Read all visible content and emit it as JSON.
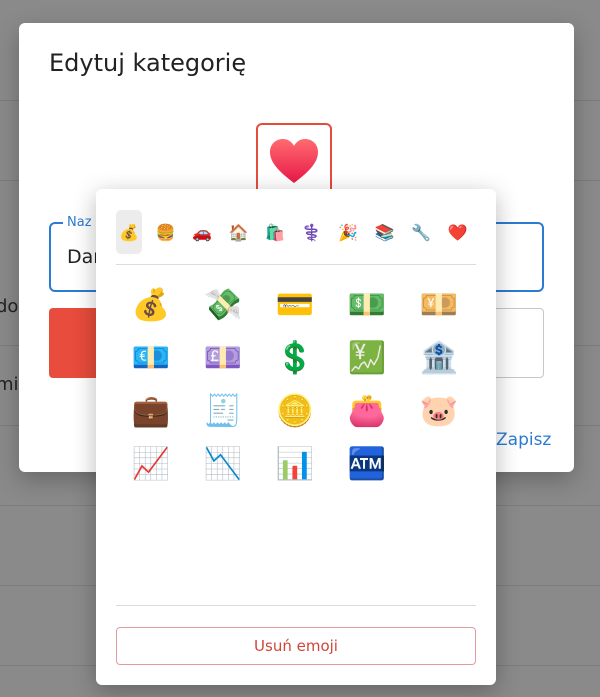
{
  "background": {
    "row_texts": [
      "do",
      "mi"
    ]
  },
  "dialog": {
    "title": "Edytuj kategorię",
    "selected_emoji": "heart",
    "name_label": "Naz",
    "name_value": "Dar",
    "save_label": "Zapisz",
    "accent_color": "#2b7bd3",
    "swatch_color": "#e74c3c"
  },
  "picker": {
    "categories": [
      {
        "glyph": "💰",
        "name": "money-bag"
      },
      {
        "glyph": "🍔",
        "name": "burger"
      },
      {
        "glyph": "🚗",
        "name": "car"
      },
      {
        "glyph": "🏠",
        "name": "house"
      },
      {
        "glyph": "🛍️",
        "name": "shopping-bags"
      },
      {
        "glyph": "⚕️",
        "name": "medical"
      },
      {
        "glyph": "🎉",
        "name": "party-popper"
      },
      {
        "glyph": "📚",
        "name": "books"
      },
      {
        "glyph": "🔧",
        "name": "wrench"
      },
      {
        "glyph": "❤️",
        "name": "heart"
      }
    ],
    "emojis": [
      {
        "glyph": "💰",
        "name": "money-bag"
      },
      {
        "glyph": "💸",
        "name": "money-with-wings"
      },
      {
        "glyph": "💳",
        "name": "credit-card"
      },
      {
        "glyph": "💵",
        "name": "dollar-banknote"
      },
      {
        "glyph": "💴",
        "name": "yen-banknote"
      },
      {
        "glyph": "💶",
        "name": "euro-banknote"
      },
      {
        "glyph": "💷",
        "name": "pound-banknote"
      },
      {
        "glyph": "💲",
        "name": "dollar-sign"
      },
      {
        "glyph": "💹",
        "name": "chart-with-yen"
      },
      {
        "glyph": "🏦",
        "name": "bank"
      },
      {
        "glyph": "💼",
        "name": "briefcase"
      },
      {
        "glyph": "🧾",
        "name": "receipt"
      },
      {
        "glyph": "🪙",
        "name": "coin"
      },
      {
        "glyph": "👛",
        "name": "purse"
      },
      {
        "glyph": "🐷",
        "name": "pig-face"
      },
      {
        "glyph": "📈",
        "name": "chart-increasing"
      },
      {
        "glyph": "📉",
        "name": "chart-decreasing"
      },
      {
        "glyph": "📊",
        "name": "bar-chart"
      },
      {
        "glyph": "🏧",
        "name": "atm"
      }
    ],
    "remove_label": "Usuń emoji",
    "remove_color": "#d0453a"
  }
}
